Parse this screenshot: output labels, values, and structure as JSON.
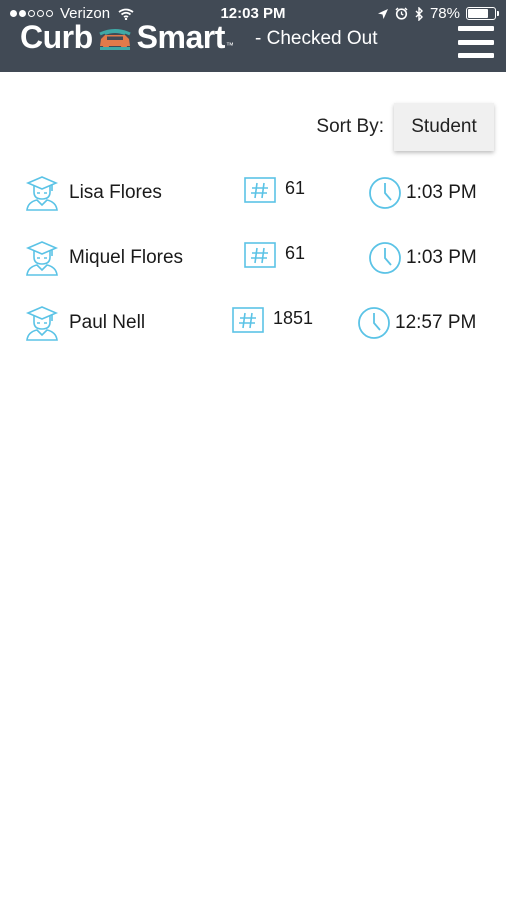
{
  "status_bar": {
    "signal_bars": 2,
    "signal_total": 5,
    "carrier": "Verizon",
    "time": "12:03 PM",
    "battery_text": "78%",
    "battery_level": 0.78,
    "icons": [
      "wifi-icon",
      "location-arrow-icon",
      "alarm-icon",
      "bluetooth-icon",
      "battery-icon"
    ]
  },
  "header": {
    "brand_left": "Curb",
    "brand_right": "Smart",
    "brand_tm": "™",
    "subtitle": "- Checked Out",
    "menu_icon": "hamburger-menu-icon"
  },
  "sort": {
    "label": "Sort By:",
    "selected": "Student"
  },
  "rows": [
    {
      "student": "Lisa Flores",
      "number": "61",
      "time": "1:03 PM"
    },
    {
      "student": "Miquel Flores",
      "number": "61",
      "time": "1:03 PM"
    },
    {
      "student": "Paul Nell",
      "number": "1851",
      "time": "12:57 PM"
    }
  ],
  "colors": {
    "header_bg": "#414a55",
    "accent": "#5bc3e6",
    "brand_car_teal": "#3fa9a6",
    "brand_car_orange": "#e07a4a"
  }
}
